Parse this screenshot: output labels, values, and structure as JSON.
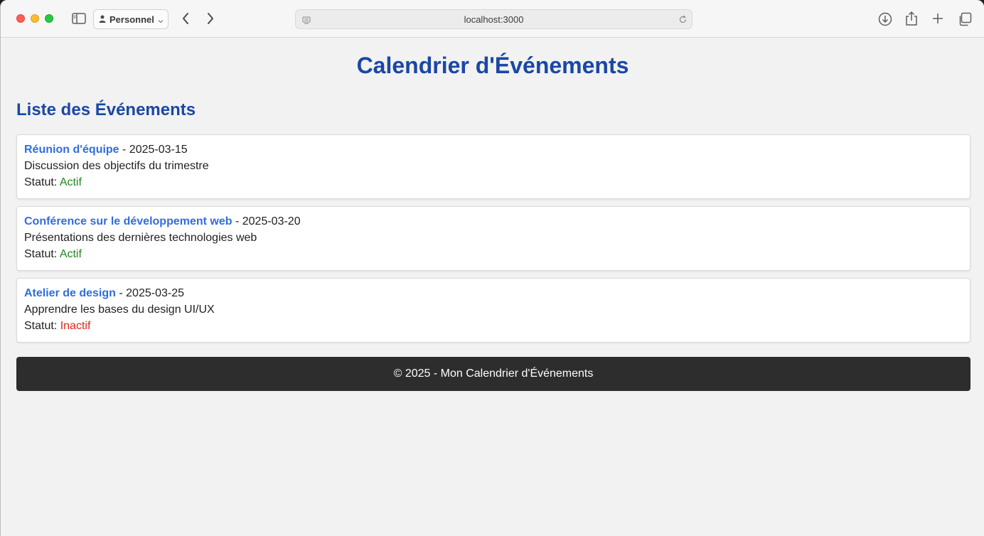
{
  "browser": {
    "profile_label": "Personnel",
    "url": "localhost:3000"
  },
  "page": {
    "title": "Calendrier d'Événements",
    "section_title": "Liste des Événements",
    "status_prefix": "Statut:",
    "date_separator": " - ",
    "events": [
      {
        "name": "Réunion d'équipe",
        "date": "2025-03-15",
        "description": "Discussion des objectifs du trimestre",
        "status": "Actif",
        "status_color": "#1f8a1f"
      },
      {
        "name": "Conférence sur le développement web",
        "date": "2025-03-20",
        "description": "Présentations des dernières technologies web",
        "status": "Actif",
        "status_color": "#1f8a1f"
      },
      {
        "name": "Atelier de design",
        "date": "2025-03-25",
        "description": "Apprendre les bases du design UI/UX",
        "status": "Inactif",
        "status_color": "#e0251b"
      }
    ],
    "footer": "© 2025 - Mon Calendrier d'Événements"
  },
  "colors": {
    "heading": "#1a47a6",
    "link": "#2f6ede",
    "footer_bg": "#2d2d2d",
    "page_bg": "#f2f2f2"
  }
}
